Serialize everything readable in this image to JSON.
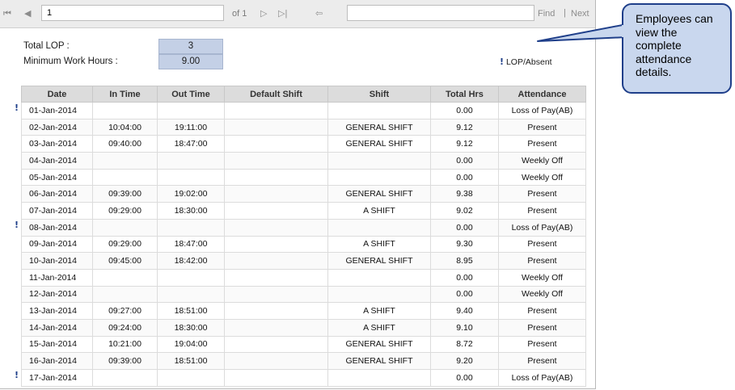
{
  "toolbar": {
    "first_icon": "⏮",
    "prev_icon": "◀",
    "page_value": "1",
    "of_label": "of 1",
    "next_icon": "▷",
    "last_icon": "▷|",
    "back_icon": "⇦",
    "find_label": "Find",
    "separator": "|",
    "next_label": "Next"
  },
  "summary": {
    "total_lop_label": "Total LOP :",
    "total_lop_value": "3",
    "min_hours_label": "Minimum Work Hours :",
    "min_hours_value": "9.00"
  },
  "legend": {
    "mark": "!",
    "label": "LOP/Absent"
  },
  "table": {
    "columns": [
      "Date",
      "In Time",
      "Out Time",
      "Default Shift",
      "Shift",
      "Total Hrs",
      "Attendance"
    ],
    "rows": [
      {
        "date": "01-Jan-2014",
        "in": "",
        "out": "",
        "default_shift": "",
        "shift": "",
        "total": "0.00",
        "attendance": "Loss of Pay(AB)",
        "flag": true
      },
      {
        "date": "02-Jan-2014",
        "in": "10:04:00",
        "out": "19:11:00",
        "default_shift": "",
        "shift": "GENERAL SHIFT",
        "total": "9.12",
        "attendance": "Present",
        "flag": false
      },
      {
        "date": "03-Jan-2014",
        "in": "09:40:00",
        "out": "18:47:00",
        "default_shift": "",
        "shift": "GENERAL SHIFT",
        "total": "9.12",
        "attendance": "Present",
        "flag": false
      },
      {
        "date": "04-Jan-2014",
        "in": "",
        "out": "",
        "default_shift": "",
        "shift": "",
        "total": "0.00",
        "attendance": "Weekly Off",
        "flag": false
      },
      {
        "date": "05-Jan-2014",
        "in": "",
        "out": "",
        "default_shift": "",
        "shift": "",
        "total": "0.00",
        "attendance": "Weekly Off",
        "flag": false
      },
      {
        "date": "06-Jan-2014",
        "in": "09:39:00",
        "out": "19:02:00",
        "default_shift": "",
        "shift": "GENERAL SHIFT",
        "total": "9.38",
        "attendance": "Present",
        "flag": false
      },
      {
        "date": "07-Jan-2014",
        "in": "09:29:00",
        "out": "18:30:00",
        "default_shift": "",
        "shift": "A SHIFT",
        "total": "9.02",
        "attendance": "Present",
        "flag": false
      },
      {
        "date": "08-Jan-2014",
        "in": "",
        "out": "",
        "default_shift": "",
        "shift": "",
        "total": "0.00",
        "attendance": "Loss of Pay(AB)",
        "flag": true
      },
      {
        "date": "09-Jan-2014",
        "in": "09:29:00",
        "out": "18:47:00",
        "default_shift": "",
        "shift": "A SHIFT",
        "total": "9.30",
        "attendance": "Present",
        "flag": false
      },
      {
        "date": "10-Jan-2014",
        "in": "09:45:00",
        "out": "18:42:00",
        "default_shift": "",
        "shift": "GENERAL SHIFT",
        "total": "8.95",
        "attendance": "Present",
        "flag": false
      },
      {
        "date": "11-Jan-2014",
        "in": "",
        "out": "",
        "default_shift": "",
        "shift": "",
        "total": "0.00",
        "attendance": "Weekly Off",
        "flag": false
      },
      {
        "date": "12-Jan-2014",
        "in": "",
        "out": "",
        "default_shift": "",
        "shift": "",
        "total": "0.00",
        "attendance": "Weekly Off",
        "flag": false
      },
      {
        "date": "13-Jan-2014",
        "in": "09:27:00",
        "out": "18:51:00",
        "default_shift": "",
        "shift": "A SHIFT",
        "total": "9.40",
        "attendance": "Present",
        "flag": false
      },
      {
        "date": "14-Jan-2014",
        "in": "09:24:00",
        "out": "18:30:00",
        "default_shift": "",
        "shift": "A SHIFT",
        "total": "9.10",
        "attendance": "Present",
        "flag": false
      },
      {
        "date": "15-Jan-2014",
        "in": "10:21:00",
        "out": "19:04:00",
        "default_shift": "",
        "shift": "GENERAL SHIFT",
        "total": "8.72",
        "attendance": "Present",
        "flag": false
      },
      {
        "date": "16-Jan-2014",
        "in": "09:39:00",
        "out": "18:51:00",
        "default_shift": "",
        "shift": "GENERAL SHIFT",
        "total": "9.20",
        "attendance": "Present",
        "flag": false
      },
      {
        "date": "17-Jan-2014",
        "in": "",
        "out": "",
        "default_shift": "",
        "shift": "",
        "total": "0.00",
        "attendance": "Loss of Pay(AB)",
        "flag": true
      }
    ]
  },
  "callout": {
    "text": "Employees can view the complete attendance details."
  },
  "colors": {
    "summary_box": "#c4d0e6",
    "callout_fill": "#c9d7ee",
    "callout_border": "#1f3f8a",
    "header_bg": "#dcdcdc"
  }
}
